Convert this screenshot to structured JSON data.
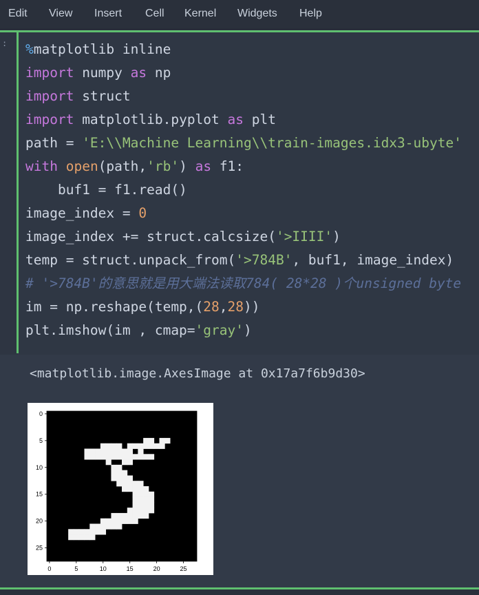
{
  "menubar": {
    "items": [
      "Edit",
      "View",
      "Insert",
      "Cell",
      "Kernel",
      "Widgets",
      "Help"
    ]
  },
  "cell": {
    "prompt": ":",
    "lines": [
      [
        {
          "t": "%",
          "c": "pct"
        },
        {
          "t": "matplotlib inline",
          "c": ""
        }
      ],
      [
        {
          "t": "import",
          "c": "kw"
        },
        {
          "t": " numpy ",
          "c": ""
        },
        {
          "t": "as",
          "c": "kw"
        },
        {
          "t": " np",
          "c": ""
        }
      ],
      [
        {
          "t": "import",
          "c": "kw"
        },
        {
          "t": " struct",
          "c": ""
        }
      ],
      [
        {
          "t": "import",
          "c": "kw"
        },
        {
          "t": " matplotlib.pyplot ",
          "c": ""
        },
        {
          "t": "as",
          "c": "kw"
        },
        {
          "t": " plt",
          "c": ""
        }
      ],
      [
        {
          "t": "path = ",
          "c": ""
        },
        {
          "t": "'E:\\\\Machine Learning\\\\train-images.idx3-ubyte'",
          "c": "str"
        }
      ],
      [
        {
          "t": "with",
          "c": "kw"
        },
        {
          "t": " ",
          "c": ""
        },
        {
          "t": "open",
          "c": "fn"
        },
        {
          "t": "(path,",
          "c": ""
        },
        {
          "t": "'rb'",
          "c": "str"
        },
        {
          "t": ") ",
          "c": ""
        },
        {
          "t": "as",
          "c": "kw"
        },
        {
          "t": " f1:",
          "c": ""
        }
      ],
      [
        {
          "t": "    buf1 = f1.read()",
          "c": ""
        }
      ],
      [
        {
          "t": "image_index = ",
          "c": ""
        },
        {
          "t": "0",
          "c": "num"
        }
      ],
      [
        {
          "t": "image_index += struct.calcsize(",
          "c": ""
        },
        {
          "t": "'>IIII'",
          "c": "str"
        },
        {
          "t": ")",
          "c": ""
        }
      ],
      [
        {
          "t": "temp = struct.unpack_from(",
          "c": ""
        },
        {
          "t": "'>784B'",
          "c": "str"
        },
        {
          "t": ", buf1, image_index)",
          "c": ""
        }
      ],
      [
        {
          "t": "# '>784B'的意思就是用大端法读取784( 28*28 )个unsigned byte",
          "c": "cmt"
        }
      ],
      [
        {
          "t": "im = np.reshape(temp,(",
          "c": ""
        },
        {
          "t": "28",
          "c": "num"
        },
        {
          "t": ",",
          "c": ""
        },
        {
          "t": "28",
          "c": "num"
        },
        {
          "t": "))",
          "c": ""
        }
      ],
      [
        {
          "t": "plt.imshow(im , cmap=",
          "c": ""
        },
        {
          "t": "'gray'",
          "c": "str"
        },
        {
          "t": ")",
          "c": ""
        }
      ]
    ]
  },
  "output": {
    "text": "<matplotlib.image.AxesImage at 0x17a7f6b9d30>"
  },
  "chart_data": {
    "type": "heatmap",
    "title": "",
    "xlabel": "",
    "ylabel": "",
    "colormap": "gray",
    "xticks": [
      "0",
      "5",
      "10",
      "15",
      "20",
      "25"
    ],
    "yticks": [
      "0",
      "5",
      "10",
      "15",
      "20",
      "25"
    ],
    "xlim": [
      -0.5,
      27.5
    ],
    "ylim": [
      27.5,
      -0.5
    ],
    "grid": false,
    "pixels": [
      "............................",
      "............................",
      "............................",
      "............................",
      "............................",
      "..................##.##.....",
      "..........####.#######......",
      ".......#########.#...........",
      ".......#############........",
      "...........#..##............",
      "............##..............",
      "............###.............",
      "............####............",
      ".............#####..........",
      "..............#####.........",
      "................####........",
      "................####........",
      "................####........",
      "...............#####........",
      "............#######.........",
      "..........#######...........",
      "........######..............",
      "....#######.................",
      "....#####...................",
      "............................",
      "............................",
      "............................",
      "............................"
    ]
  }
}
